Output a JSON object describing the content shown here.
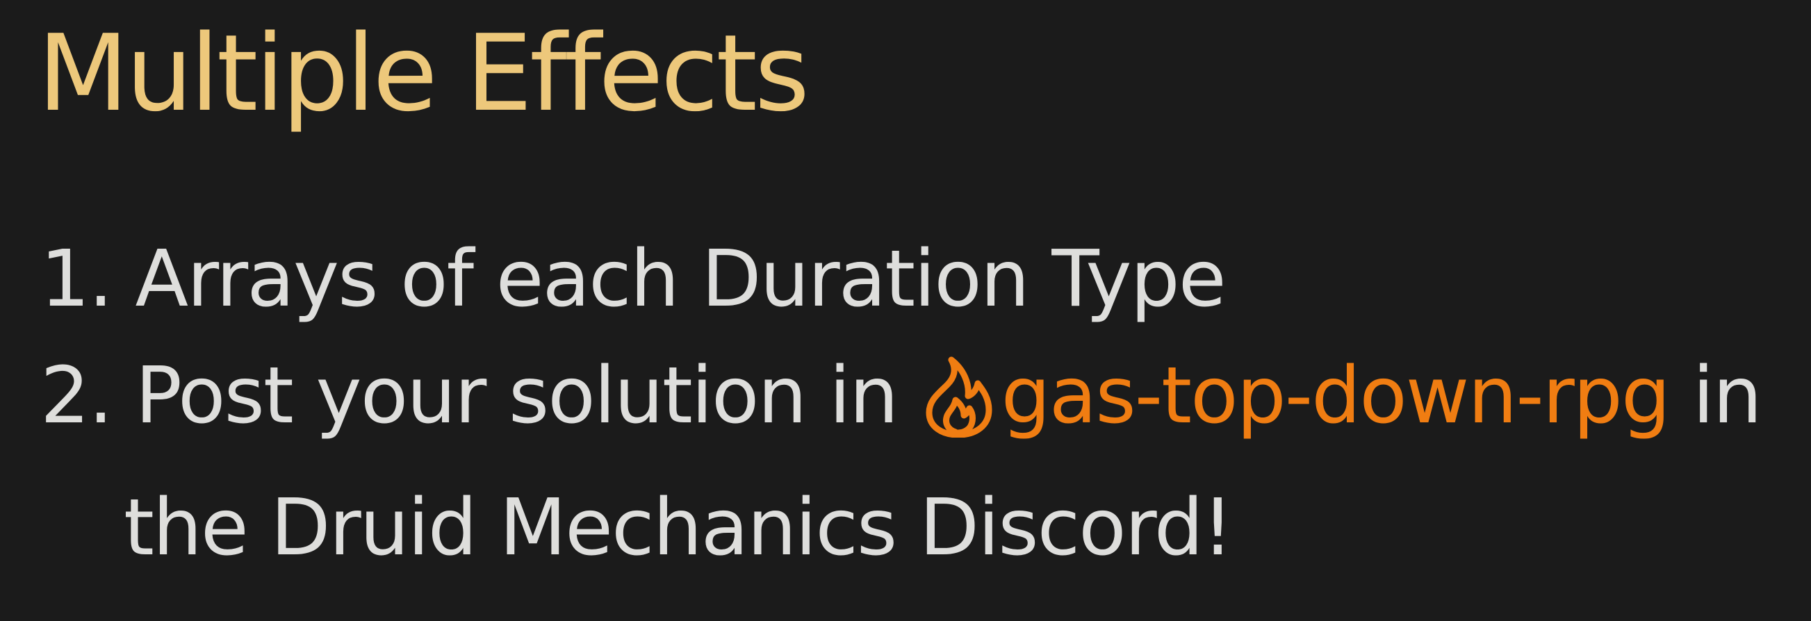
{
  "slide": {
    "title": "Multiple Effects",
    "items": [
      {
        "number": "1.",
        "text": "Arrays of each Duration Type"
      },
      {
        "number": "2.",
        "text_before": "Post your solution in ",
        "channel": {
          "icon": "flame-icon",
          "name": "gas-top-down-rpg"
        },
        "text_after": " in",
        "continuation": "the Druid Mechanics Discord!"
      }
    ]
  },
  "colors": {
    "background": "#1b1b1b",
    "title": "#edc87b",
    "body_text": "#dededc",
    "channel_accent": "#f07d12"
  }
}
